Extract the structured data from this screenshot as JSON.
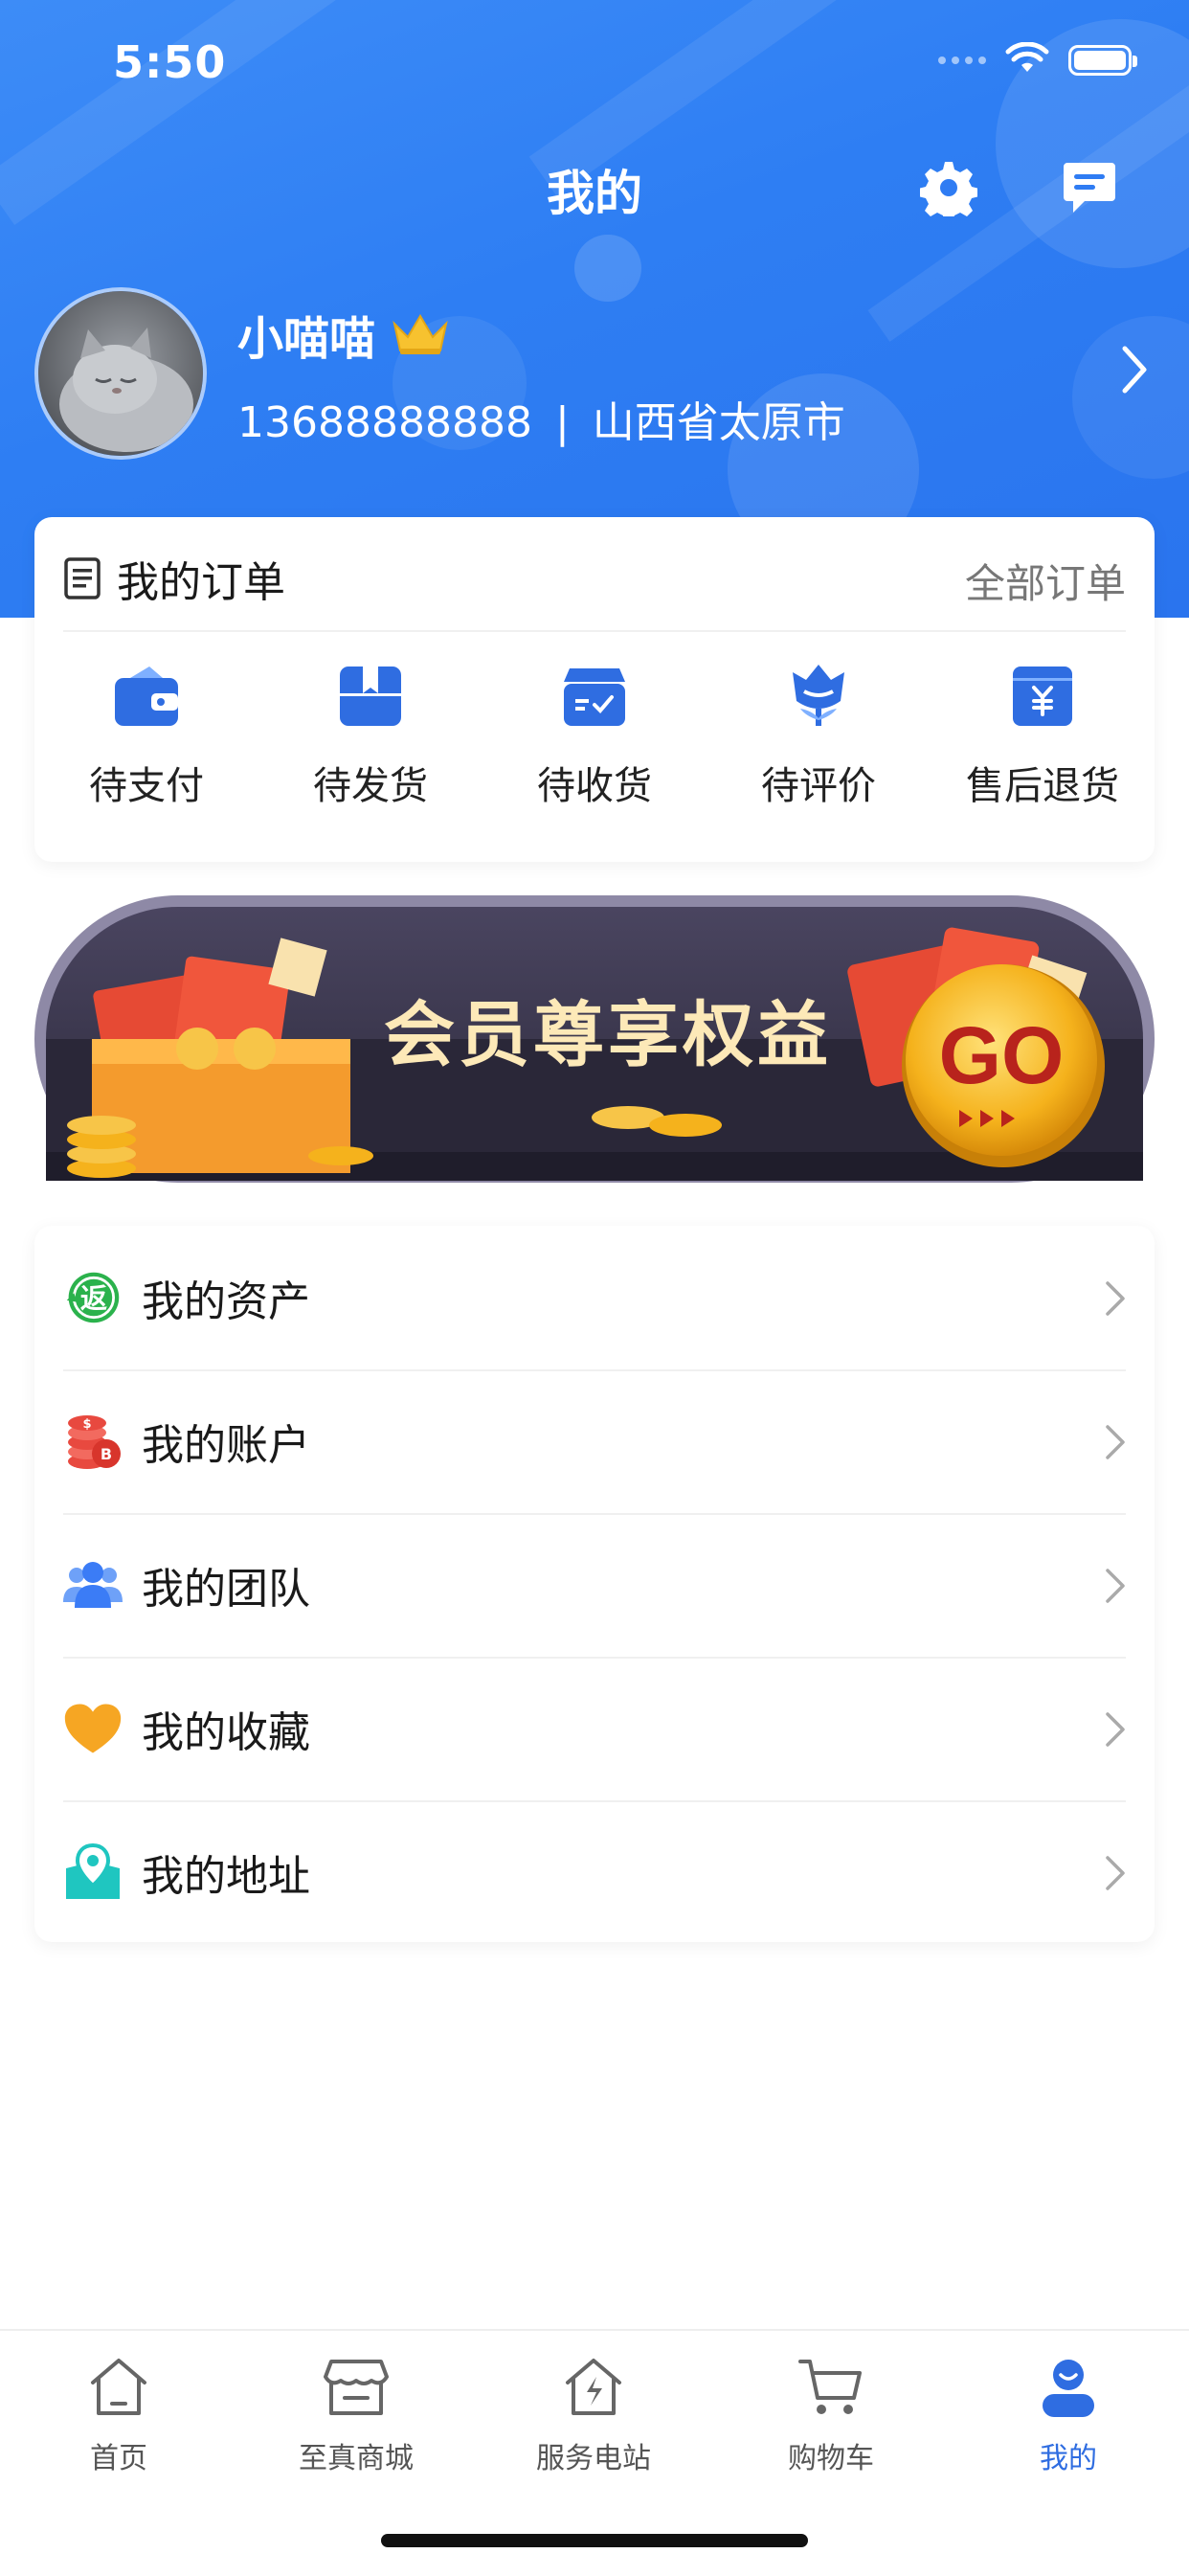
{
  "status_bar": {
    "time": "5:50"
  },
  "nav": {
    "title": "我的"
  },
  "profile": {
    "username": "小喵喵",
    "phone": "13688888888",
    "separator": "|",
    "location": "山西省太原市"
  },
  "orders": {
    "title": "我的订单",
    "all_label": "全部订单",
    "items": [
      {
        "label": "待支付",
        "icon": "wallet-icon"
      },
      {
        "label": "待发货",
        "icon": "box-icon"
      },
      {
        "label": "待收货",
        "icon": "receive-box-icon"
      },
      {
        "label": "待评价",
        "icon": "flower-icon"
      },
      {
        "label": "售后退货",
        "icon": "refund-icon"
      }
    ]
  },
  "banner": {
    "text": "会员尊享权益",
    "go_label": "GO"
  },
  "menu": {
    "items": [
      {
        "label": "我的资产",
        "icon": "rebate-icon",
        "icon_text": "返"
      },
      {
        "label": "我的账户",
        "icon": "coins-icon"
      },
      {
        "label": "我的团队",
        "icon": "team-icon"
      },
      {
        "label": "我的收藏",
        "icon": "heart-icon"
      },
      {
        "label": "我的地址",
        "icon": "location-icon"
      }
    ]
  },
  "tabbar": {
    "items": [
      {
        "label": "首页",
        "icon": "home-icon"
      },
      {
        "label": "至真商城",
        "icon": "store-icon"
      },
      {
        "label": "服务电站",
        "icon": "power-station-icon"
      },
      {
        "label": "购物车",
        "icon": "cart-icon"
      },
      {
        "label": "我的",
        "icon": "user-icon",
        "active": true
      }
    ]
  },
  "colors": {
    "primary": "#2f7cf3",
    "active_tab": "#2f6de1",
    "heart": "#f6a623",
    "rebate": "#2bb24c",
    "location": "#1fc6c0",
    "team": "#3b7cf6",
    "coins": "#e8493f"
  }
}
